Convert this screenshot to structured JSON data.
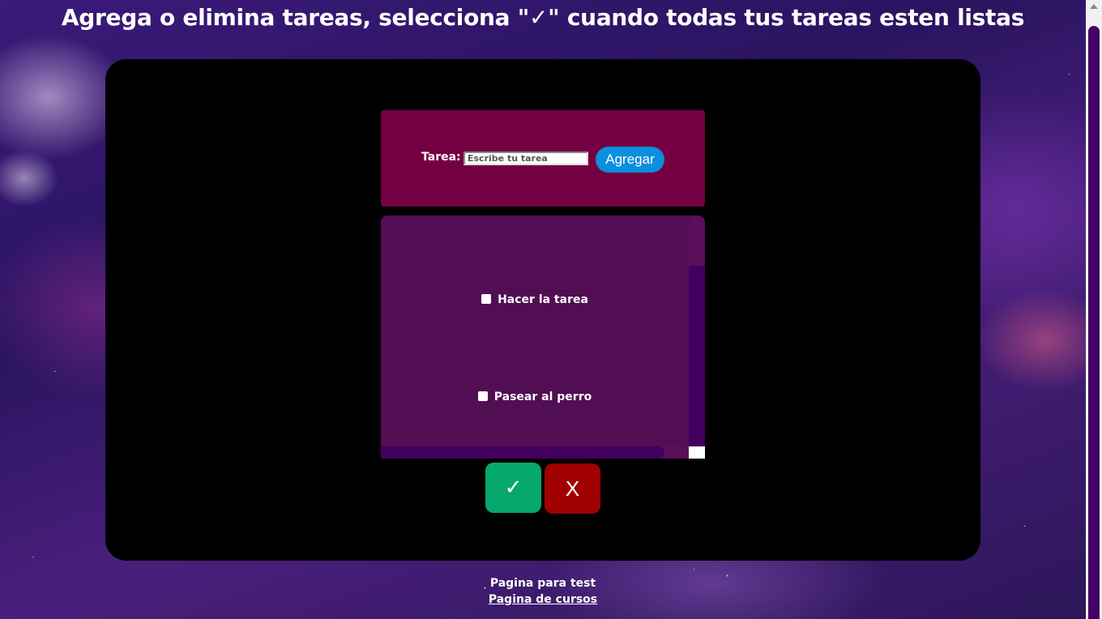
{
  "page": {
    "title": "Agrega o elimina tareas, selecciona \"✓\" cuando todas tus tareas esten listas"
  },
  "form": {
    "label": "Tarea:",
    "input_placeholder": "Escribe tu tarea",
    "input_value": "",
    "add_button_label": "Agregar"
  },
  "tasks": [
    {
      "label": "Hacer la tarea",
      "checked": false
    },
    {
      "label": "Pasear al perro",
      "checked": false
    }
  ],
  "actions": {
    "done_label": "✓",
    "clear_label": "X"
  },
  "footer": {
    "test_text": "Pagina para test",
    "courses_link": "Pagina de cursos"
  },
  "colors": {
    "card_background": "#000000",
    "form_background": "#730041",
    "list_background": "#520e52",
    "add_button": "#0b8fde",
    "done_button": "#07a86d",
    "clear_button": "#a00000",
    "scroll_thumb": "#42005e"
  },
  "icons": {
    "done": "check-icon",
    "clear": "x-icon"
  }
}
